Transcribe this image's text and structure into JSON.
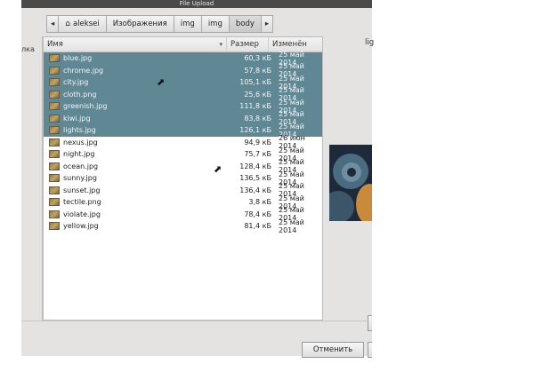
{
  "window": {
    "title": "File Upload"
  },
  "sidebar": {
    "label": "лка"
  },
  "pathbar": {
    "back": "◂",
    "forward": "▸",
    "home_icon": "⌂",
    "crumbs": [
      "aleksei",
      "Изображения",
      "img",
      "img",
      "body"
    ]
  },
  "columns": {
    "name": "Имя",
    "size": "Размер",
    "modified": "Изменён",
    "sort_icon": "▾"
  },
  "files": [
    {
      "name": "blue.jpg",
      "size": "60,3 кБ",
      "modified": "25 май 2014",
      "selected": true
    },
    {
      "name": "chrome.jpg",
      "size": "57,8 кБ",
      "modified": "25 май 2014",
      "selected": true
    },
    {
      "name": "city.jpg",
      "size": "105,1 кБ",
      "modified": "25 май 2014",
      "selected": true
    },
    {
      "name": "cloth.png",
      "size": "25,6 кБ",
      "modified": "25 май 2014",
      "selected": true
    },
    {
      "name": "greenish.jpg",
      "size": "111,8 кБ",
      "modified": "25 май 2014",
      "selected": true
    },
    {
      "name": "kiwi.jpg",
      "size": "83,8 кБ",
      "modified": "25 май 2014",
      "selected": true
    },
    {
      "name": "lights.jpg",
      "size": "126,1 кБ",
      "modified": "25 май 2014",
      "selected": true
    },
    {
      "name": "nexus.jpg",
      "size": "94,9 кБ",
      "modified": "26 июн 2014",
      "selected": false
    },
    {
      "name": "night.jpg",
      "size": "75,7 кБ",
      "modified": "25 май 2014",
      "selected": false
    },
    {
      "name": "ocean.jpg",
      "size": "128,4 кБ",
      "modified": "25 май 2014",
      "selected": false
    },
    {
      "name": "sunny.jpg",
      "size": "136,5 кБ",
      "modified": "25 май 2014",
      "selected": false
    },
    {
      "name": "sunset.jpg",
      "size": "136,4 кБ",
      "modified": "25 май 2014",
      "selected": false
    },
    {
      "name": "tectile.png",
      "size": "3,8 кБ",
      "modified": "25 май 2014",
      "selected": false
    },
    {
      "name": "violate.jpg",
      "size": "78,4 кБ",
      "modified": "25 май 2014",
      "selected": false
    },
    {
      "name": "yellow.jpg",
      "size": "81,4 кБ",
      "modified": "25 май 2014",
      "selected": false
    }
  ],
  "preview": {
    "label": "lig"
  },
  "footer": {
    "cancel_label": "Отменить"
  },
  "colors": {
    "selection": "#5f8794",
    "titlebar": "#4a4a4a",
    "dialog_bg": "#e4e3e1"
  }
}
